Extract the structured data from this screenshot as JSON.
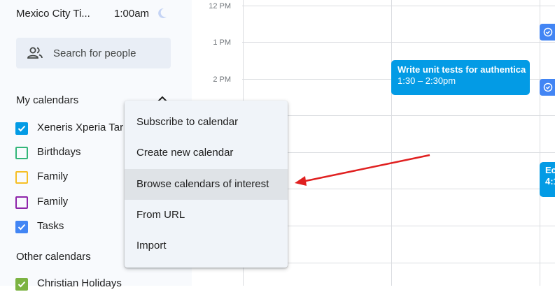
{
  "sidebar": {
    "timezone": {
      "name": "Mexico City Ti...",
      "time": "1:00am",
      "icon": "moon-icon"
    },
    "search": {
      "placeholder": "Search for people",
      "icon": "people-icon"
    },
    "my_calendars": {
      "title": "My calendars",
      "items": [
        {
          "label": "Xeneris Xperia Tar",
          "checked": true,
          "color": "#039be5"
        },
        {
          "label": "Birthdays",
          "checked": false,
          "color": "#33b679"
        },
        {
          "label": "Family",
          "checked": false,
          "color": "#f6bf26"
        },
        {
          "label": "Family",
          "checked": false,
          "color": "#8e24aa"
        },
        {
          "label": "Tasks",
          "checked": true,
          "color": "#4285f4"
        }
      ]
    },
    "other_calendars": {
      "title": "Other calendars",
      "items": [
        {
          "label": "Christian Holidays",
          "checked": true,
          "color": "#7cb342"
        }
      ]
    }
  },
  "grid": {
    "times": [
      "12 PM",
      "1 PM",
      "2 PM"
    ],
    "event": {
      "title": "Write unit tests for authentica",
      "time": "1:30 – 2:30pm",
      "color": "#039be5"
    },
    "event2": {
      "title": "Ec",
      "time": "4:1"
    }
  },
  "menu": {
    "items": [
      "Subscribe to calendar",
      "Create new calendar",
      "Browse calendars of interest",
      "From URL",
      "Import"
    ],
    "highlighted_index": 2
  },
  "annotation": {
    "arrow_color": "#e02020"
  }
}
